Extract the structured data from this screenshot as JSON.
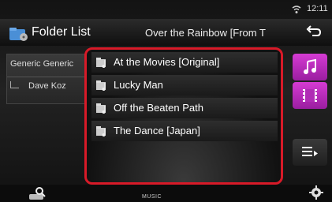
{
  "status": {
    "time": "12:11",
    "wifi_icon": "wifi-icon"
  },
  "header": {
    "title": "Folder List",
    "now_playing": "Over the Rainbow [From T",
    "back_icon": "back-icon"
  },
  "folder_path": {
    "root": "Generic Generic",
    "child": "Dave Koz"
  },
  "list": {
    "highlight_color": "#d81a28",
    "items": [
      {
        "label": "At the Movies [Original]"
      },
      {
        "label": "Lucky Man"
      },
      {
        "label": "Off the Beaten Path"
      },
      {
        "label": "The Dance [Japan]"
      }
    ]
  },
  "side_buttons": {
    "accent": "#c22fc4",
    "music_icon": "music-note-icon",
    "video_icon": "video-icon",
    "queue_icon": "queue-icon"
  },
  "bottom": {
    "source_label": "MUSIC",
    "search_icon": "search-icon",
    "settings_icon": "gear-icon"
  }
}
